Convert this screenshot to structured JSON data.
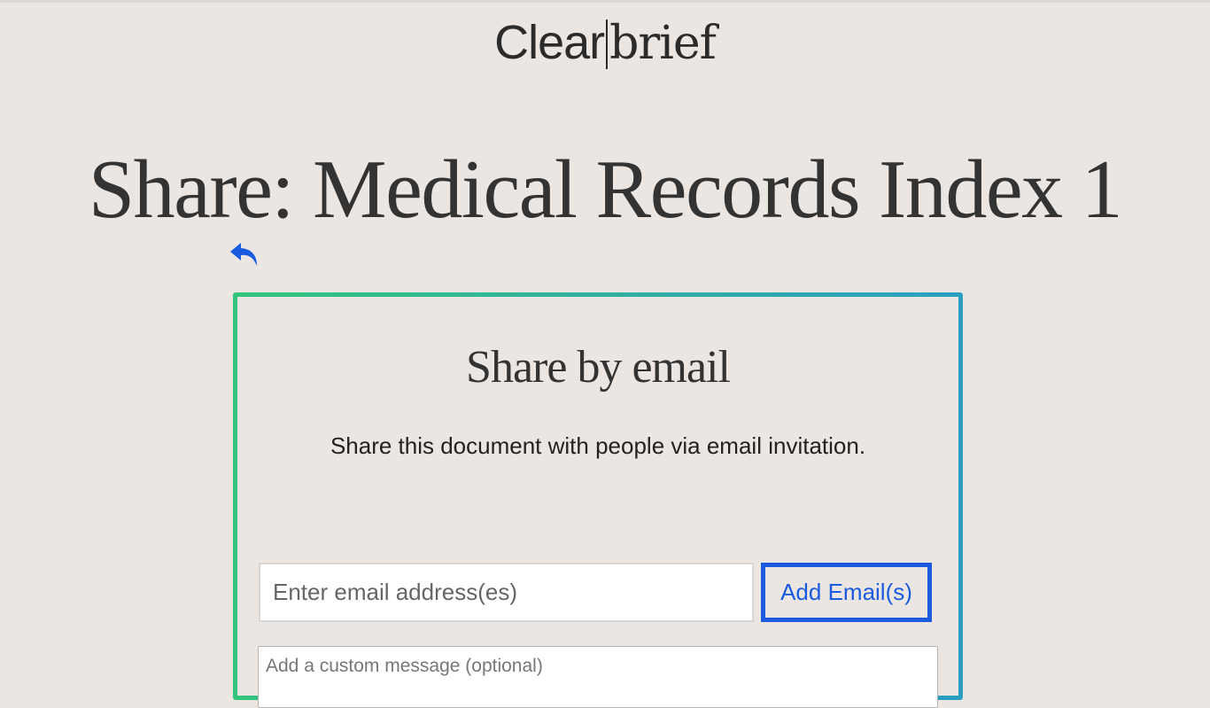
{
  "header": {
    "logo_part1": "Clear",
    "logo_part2": "brief"
  },
  "page": {
    "title": "Share: Medical Records Index 1",
    "back_icon": "reply-arrow-icon"
  },
  "share_card": {
    "title": "Share by email",
    "description": "Share this document with people via email invitation.",
    "email_input": {
      "value": "",
      "placeholder": "Enter email address(es)"
    },
    "add_button_label": "Add Email(s)",
    "message_input": {
      "value": "",
      "placeholder": "Add a custom message (optional)"
    }
  },
  "colors": {
    "background": "#ebe6e2",
    "accent_blue": "#1a5bdf",
    "gradient_start": "#34c47c",
    "gradient_end": "#2a9fc2",
    "text": "#333333"
  }
}
